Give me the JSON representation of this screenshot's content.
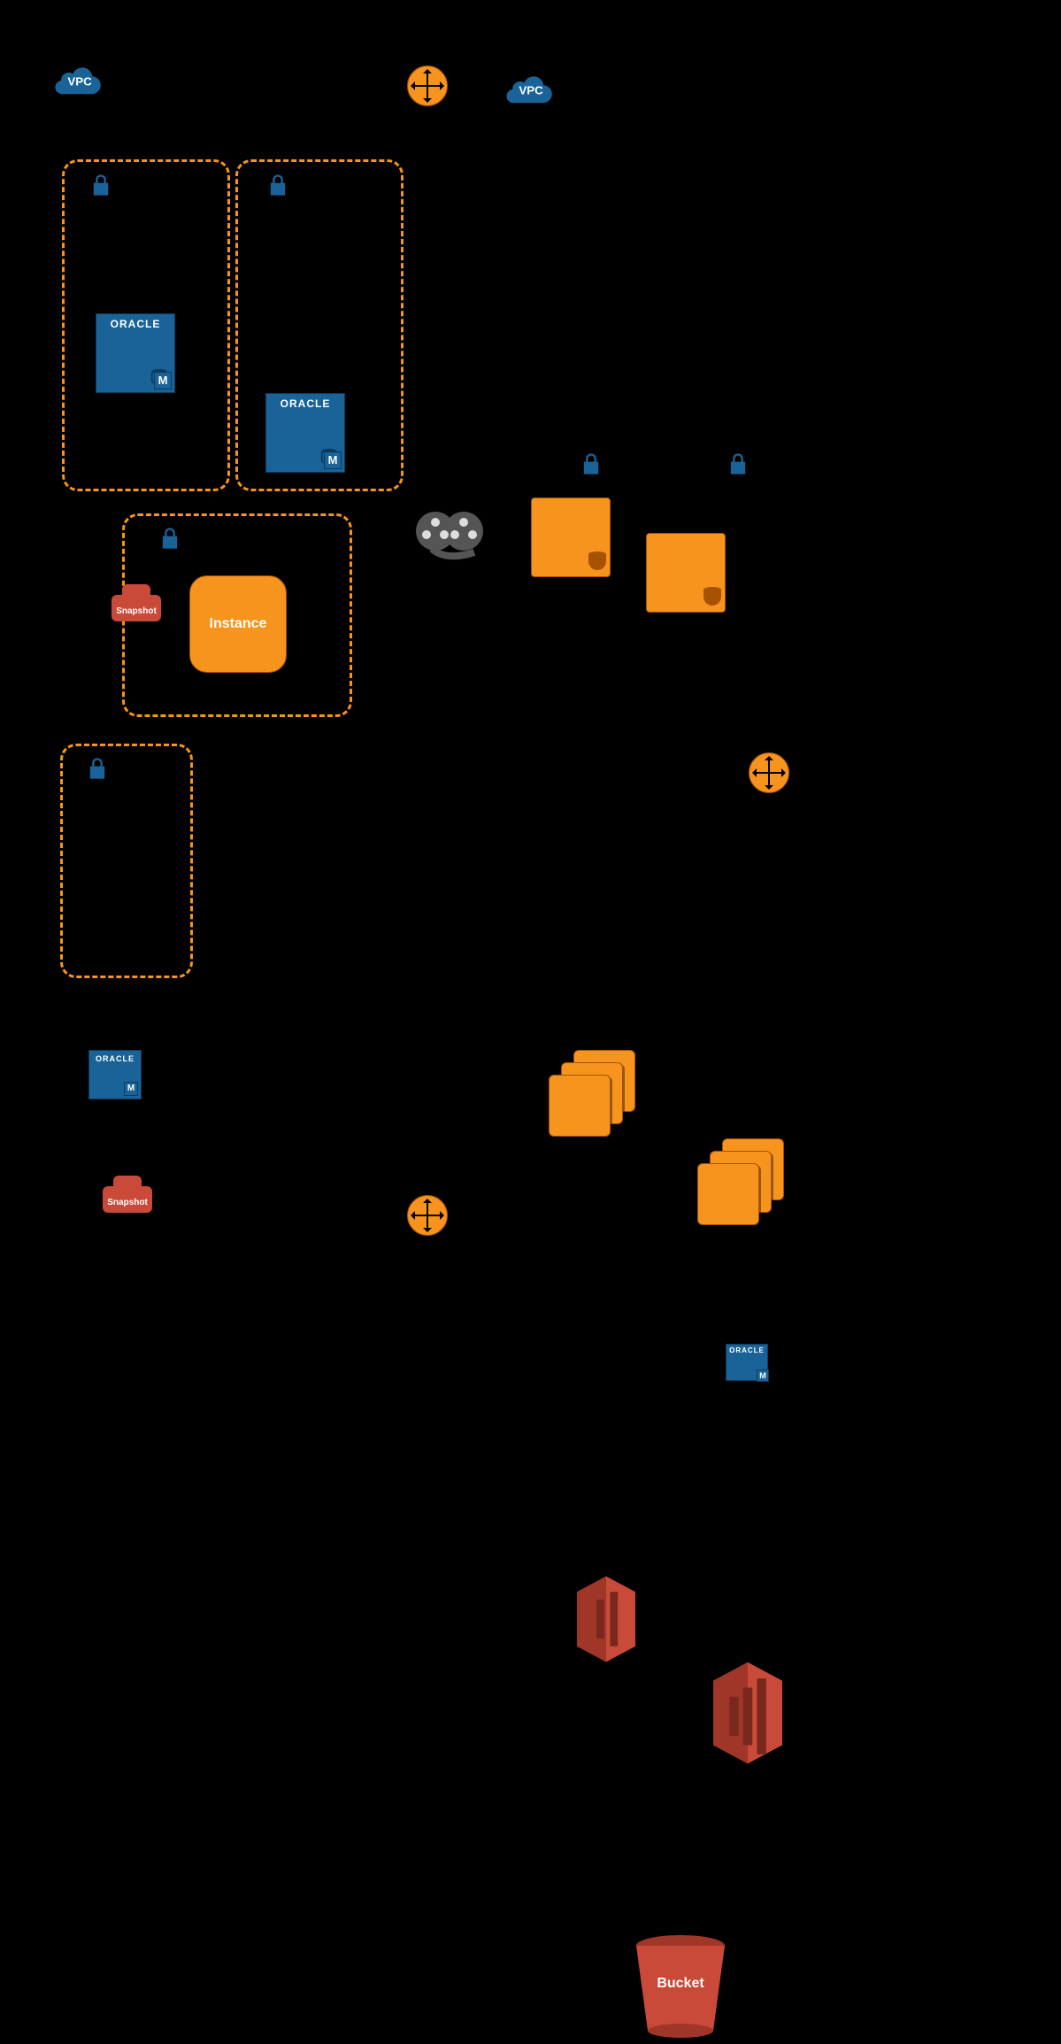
{
  "left": {
    "vpc_label": "VPC",
    "subnet1": {
      "oracle_label": "ORACLE",
      "oracle_m": "M",
      "snapshot_label": "Snapshot"
    },
    "subnet2": {
      "oracle_label": "ORACLE",
      "oracle_m": "M"
    },
    "subnet3": {
      "instance_label": "Instance"
    },
    "subnet4": {
      "oracle_label": "ORACLE",
      "oracle_m": "M",
      "snapshot_label": "Snapshot"
    }
  },
  "right": {
    "vpc_label": "VPC",
    "oracle_small": {
      "label": "ORACLE",
      "m": "M"
    },
    "bucket_label": "Bucket"
  }
}
